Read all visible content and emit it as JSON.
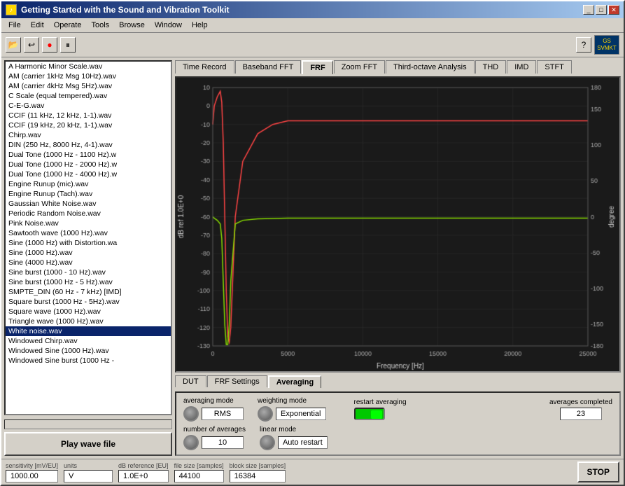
{
  "window": {
    "title": "Getting Started with the Sound and Vibration Toolkit",
    "title_icon": "♪",
    "buttons": {
      "minimize": "_",
      "maximize": "□",
      "close": "✕"
    }
  },
  "menu": {
    "items": [
      "File",
      "Edit",
      "Operate",
      "Tools",
      "Browse",
      "Window",
      "Help"
    ]
  },
  "toolbar": {
    "buttons": [
      "📂",
      "↩",
      "●",
      "⏸"
    ],
    "right_icon": "GS\nSVMKT"
  },
  "tabs": {
    "main": [
      {
        "label": "Time Record",
        "active": false
      },
      {
        "label": "Baseband FFT",
        "active": false
      },
      {
        "label": "FRF",
        "active": true
      },
      {
        "label": "Zoom FFT",
        "active": false
      },
      {
        "label": "Third-octave Analysis",
        "active": false
      },
      {
        "label": "THD",
        "active": false
      },
      {
        "label": "IMD",
        "active": false
      },
      {
        "label": "STFT",
        "active": false
      }
    ],
    "bottom": [
      {
        "label": "DUT",
        "active": false
      },
      {
        "label": "FRF Settings",
        "active": false
      },
      {
        "label": "Averaging",
        "active": true
      }
    ]
  },
  "file_list": {
    "items": [
      "A Harmonic Minor Scale.wav",
      "AM (carrier 1kHz Msg 10Hz).wav",
      "AM (carrier 4kHz Msg 5Hz).wav",
      "C Scale (equal tempered).wav",
      "C-E-G.wav",
      "CCIF (11 kHz, 12 kHz, 1-1).wav",
      "CCIF (19 kHz, 20 kHz, 1-1).wav",
      "Chirp.wav",
      "DIN (250 Hz, 8000 Hz, 4-1).wav",
      "Dual Tone (1000 Hz - 1100 Hz).w",
      "Dual Tone (1000 Hz - 2000 Hz).w",
      "Dual Tone (1000 Hz - 4000 Hz).w",
      "Engine Runup (mic).wav",
      "Engine Runup (Tach).wav",
      "Gaussian White Noise.wav",
      "Periodic Random Noise.wav",
      "Pink Noise.wav",
      "Sawtooth wave (1000 Hz).wav",
      "Sine (1000 Hz) with Distortion.wa",
      "Sine (1000 Hz).wav",
      "Sine (4000 Hz).wav",
      "Sine burst (1000 - 10 Hz).wav",
      "Sine burst (1000 Hz - 5 Hz).wav",
      "SMPTE_DIN (60 Hz - 7 kHz) [IMD]",
      "Square burst (1000 Hz - 5Hz).wav",
      "Square wave (1000 Hz).wav",
      "Triangle wave (1000 Hz).wav",
      "White noise.wav",
      "Windowed Chirp.wav",
      "Windowed Sine (1000 Hz).wav",
      "Windowed Sine burst (1000 Hz -"
    ],
    "selected_index": 27
  },
  "play_button": {
    "label": "Play wave file"
  },
  "chart": {
    "x_label": "Frequency [Hz]",
    "y_left_label": "dB ref 1.0E+0",
    "y_right_label": "degree",
    "x_ticks": [
      "0",
      "5000",
      "10000",
      "15000",
      "20000",
      "25000"
    ],
    "y_left_ticks": [
      "10",
      "0",
      "-10",
      "-20",
      "-30",
      "-40",
      "-50",
      "-60",
      "-70",
      "-80",
      "-90",
      "-100",
      "-110",
      "-120",
      "-130"
    ],
    "y_right_ticks": [
      "180",
      "150",
      "100",
      "50",
      "0",
      "-50",
      "-100",
      "-150",
      "-180"
    ]
  },
  "averaging": {
    "averaging_mode": {
      "label": "averaging mode",
      "value": "RMS"
    },
    "weighting_mode": {
      "label": "weighting mode",
      "value": "Exponential"
    },
    "number_of_averages": {
      "label": "number of averages",
      "value": "10"
    },
    "linear_mode": {
      "label": "linear mode",
      "value": "Auto restart"
    },
    "restart_averaging": {
      "label": "restart averaging"
    },
    "averages_completed": {
      "label": "averages completed",
      "value": "23"
    }
  },
  "status_bar": {
    "sensitivity": {
      "label": "sensitivity [mV/EU]",
      "value": "1000.00"
    },
    "units": {
      "label": "units",
      "value": "V"
    },
    "db_reference": {
      "label": "dB reference [EU]",
      "value": "1.0E+0"
    },
    "file_size": {
      "label": "file size [samples]",
      "value": "44100"
    },
    "block_size": {
      "label": "block size [samples]",
      "value": "16384"
    },
    "stop_button": "STOP"
  }
}
